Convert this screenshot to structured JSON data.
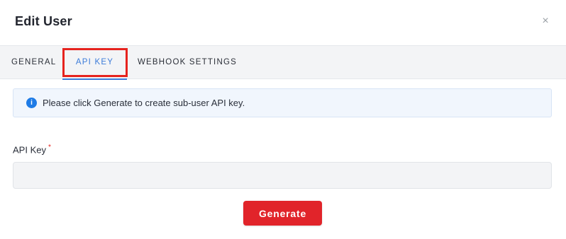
{
  "modal": {
    "title": "Edit User",
    "close_glyph": "×"
  },
  "tabs": [
    {
      "label": "GENERAL",
      "active": false
    },
    {
      "label": "API KEY",
      "active": true
    },
    {
      "label": "WEBHOOK SETTINGS",
      "active": false
    }
  ],
  "info": {
    "icon": "info-icon",
    "icon_glyph": "i",
    "text": "Please click Generate to create sub-user API key."
  },
  "form": {
    "api_key_label": "API Key",
    "required_mark": "*",
    "api_key_value": ""
  },
  "actions": {
    "generate_label": "Generate"
  },
  "colors": {
    "accent": "#3b7bd9",
    "primary_button": "#e1242a",
    "highlight_box": "#e6231e",
    "info_background": "#f1f6fd"
  }
}
